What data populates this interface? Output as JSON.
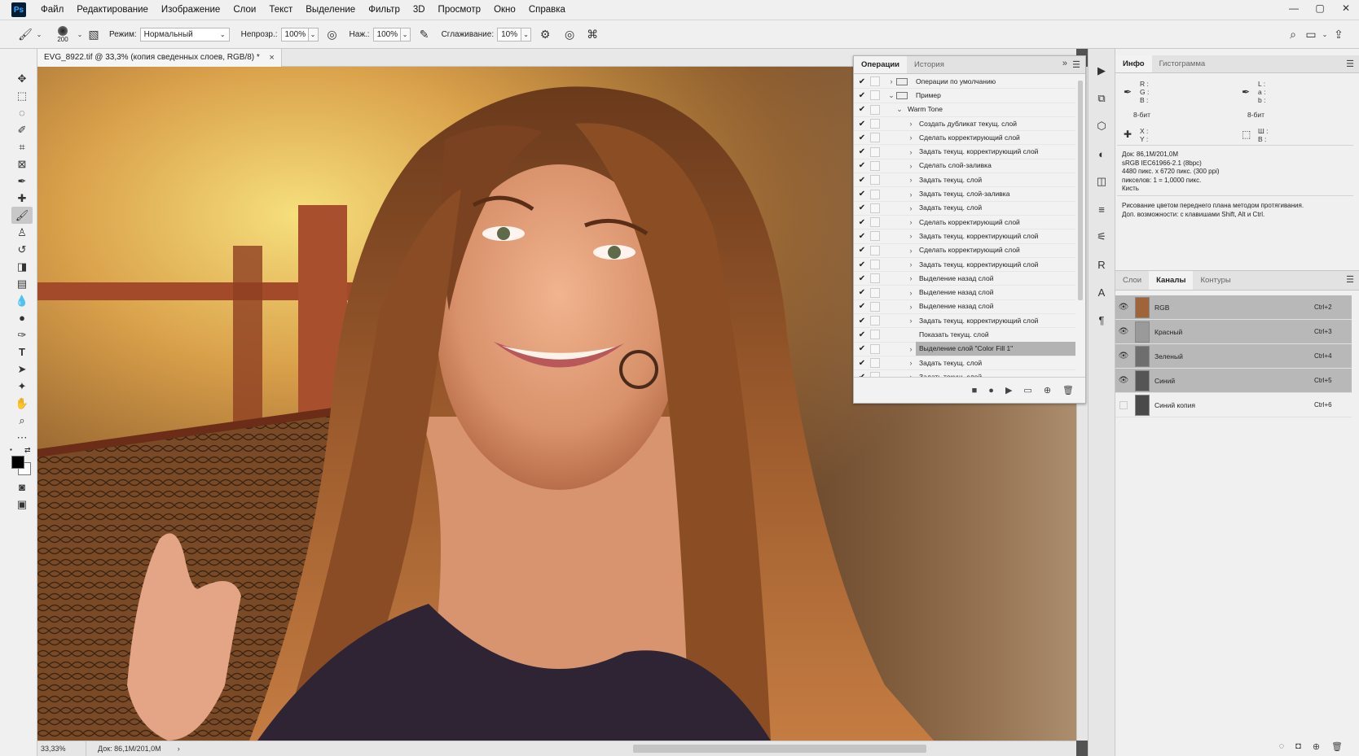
{
  "app": {
    "logo": "Ps"
  },
  "menu": [
    "Файл",
    "Редактирование",
    "Изображение",
    "Слои",
    "Текст",
    "Выделение",
    "Фильтр",
    "3D",
    "Просмотр",
    "Окно",
    "Справка"
  ],
  "options": {
    "brush_size": "200",
    "mode_label": "Режим:",
    "mode_value": "Нормальный",
    "opacity_label": "Непрозр.:",
    "opacity_value": "100%",
    "flow_label": "Наж.:",
    "flow_value": "100%",
    "smoothing_label": "Сглаживание:",
    "smoothing_value": "10%"
  },
  "document": {
    "tab_title": "EVG_8922.tif @ 33,3% (копия сведенных слоев, RGB/8) *",
    "zoom": "33,33%",
    "doc_info": "Док: 86,1M/201,0M"
  },
  "actions_panel": {
    "tabs": [
      "Операции",
      "История"
    ],
    "items": [
      {
        "label": "Операции по умолчанию",
        "level": 0,
        "folder": true,
        "arrow": "›"
      },
      {
        "label": "Пример",
        "level": 0,
        "folder": true,
        "arrow": "⌄"
      },
      {
        "label": "Warm Tone",
        "level": 1,
        "arrow": "⌄"
      },
      {
        "label": "Создать дубликат текущ. слой",
        "level": 2,
        "arrow": "›"
      },
      {
        "label": "Сделать корректирующий слой",
        "level": 2,
        "arrow": "›"
      },
      {
        "label": "Задать текущ. корректирующий слой",
        "level": 2,
        "arrow": "›"
      },
      {
        "label": "Сделать слой-заливка",
        "level": 2,
        "arrow": "›"
      },
      {
        "label": "Задать текущ. слой",
        "level": 2,
        "arrow": "›"
      },
      {
        "label": "Задать текущ. слой-заливка",
        "level": 2,
        "arrow": "›"
      },
      {
        "label": "Задать текущ. слой",
        "level": 2,
        "arrow": "›"
      },
      {
        "label": "Сделать корректирующий слой",
        "level": 2,
        "arrow": "›"
      },
      {
        "label": "Задать текущ. корректирующий слой",
        "level": 2,
        "arrow": "›"
      },
      {
        "label": "Сделать корректирующий слой",
        "level": 2,
        "arrow": "›"
      },
      {
        "label": "Задать текущ. корректирующий слой",
        "level": 2,
        "arrow": "›"
      },
      {
        "label": "Выделение назад слой",
        "level": 2,
        "arrow": "›"
      },
      {
        "label": "Выделение назад слой",
        "level": 2,
        "arrow": "›"
      },
      {
        "label": "Выделение назад слой",
        "level": 2,
        "arrow": "›"
      },
      {
        "label": "Задать текущ. корректирующий слой",
        "level": 2,
        "arrow": "›"
      },
      {
        "label": "Показать текущ. слой",
        "level": 2,
        "arrow": ""
      },
      {
        "label": "Выделение слой \"Color Fill 1\"",
        "level": 2,
        "arrow": "›",
        "selected": true
      },
      {
        "label": "Задать текущ. слой",
        "level": 2,
        "arrow": "›"
      },
      {
        "label": "Задать текущ. слой",
        "level": 2,
        "arrow": "›"
      }
    ]
  },
  "info_panel": {
    "tabs": [
      "Инфо",
      "Гистограмма"
    ],
    "rgb_labels": "R :\nG :\nB :",
    "lab_labels": "L :\na :\nb :",
    "bit_left": "8-бит",
    "bit_right": "8-бит",
    "xy_labels": "X :\nY :",
    "wh_labels": "Ш :\nВ :",
    "doc_lines": [
      "Док: 86,1M/201,0M",
      "sRGB IEC61966-2.1 (8bpc)",
      "4480 пикс. x 6720 пикс. (300 ppi)",
      "пикселов: 1 = 1,0000 пикс.",
      "Кисть"
    ],
    "hint_lines": [
      "Рисование цветом переднего плана методом протягивания.",
      "Доп. возможности: с клавишами Shift, Alt и Ctrl."
    ]
  },
  "channels_panel": {
    "tabs": [
      "Слои",
      "Каналы",
      "Контуры"
    ],
    "channels": [
      {
        "name": "RGB",
        "key": "Ctrl+2",
        "visible": true,
        "selected": true,
        "thumb": "#a0643a"
      },
      {
        "name": "Красный",
        "key": "Ctrl+3",
        "visible": true,
        "selected": true,
        "thumb": "#9a9a9a"
      },
      {
        "name": "Зеленый",
        "key": "Ctrl+4",
        "visible": true,
        "selected": true,
        "thumb": "#6e6e6e"
      },
      {
        "name": "Синий",
        "key": "Ctrl+5",
        "visible": true,
        "selected": true,
        "thumb": "#555555"
      },
      {
        "name": "Синий копия",
        "key": "Ctrl+6",
        "visible": false,
        "selected": false,
        "thumb": "#4a4a4a"
      }
    ]
  },
  "colors": {
    "selection": "#b8b8b8",
    "panel_bg": "#f0f0f0"
  }
}
